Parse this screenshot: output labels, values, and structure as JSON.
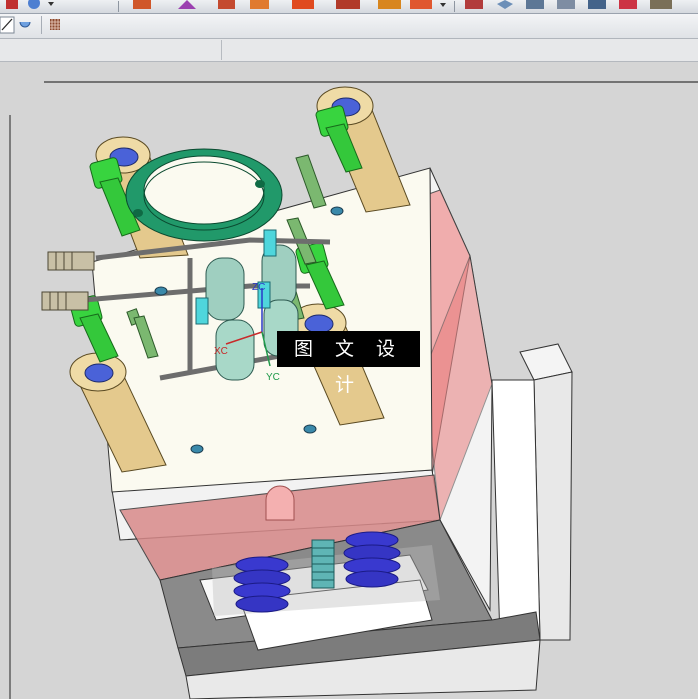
{
  "viewport": {
    "watermark_text": "图 文 设 计",
    "csys": {
      "z_label": "ZC",
      "x_label": "XC",
      "y_label": "YC"
    }
  },
  "toolbar": {
    "icons": [
      "cube-icon",
      "sphere-icon",
      "mold-wizard-icon",
      "triangle-icon",
      "component-icon",
      "cooling-icon",
      "slider-icon",
      "ejector-icon",
      "electrode-icon",
      "view-icon",
      "shade-icon",
      "fit-icon",
      "layer-icon",
      "color-icon",
      "render-icon"
    ]
  },
  "colors": {
    "plate": "#f5f4e8",
    "plate_red": "#e79b9b",
    "bush": "#e3c98e",
    "bolt": "#37d23f",
    "ring": "#219a6a",
    "spring": "#3a3bcc"
  }
}
